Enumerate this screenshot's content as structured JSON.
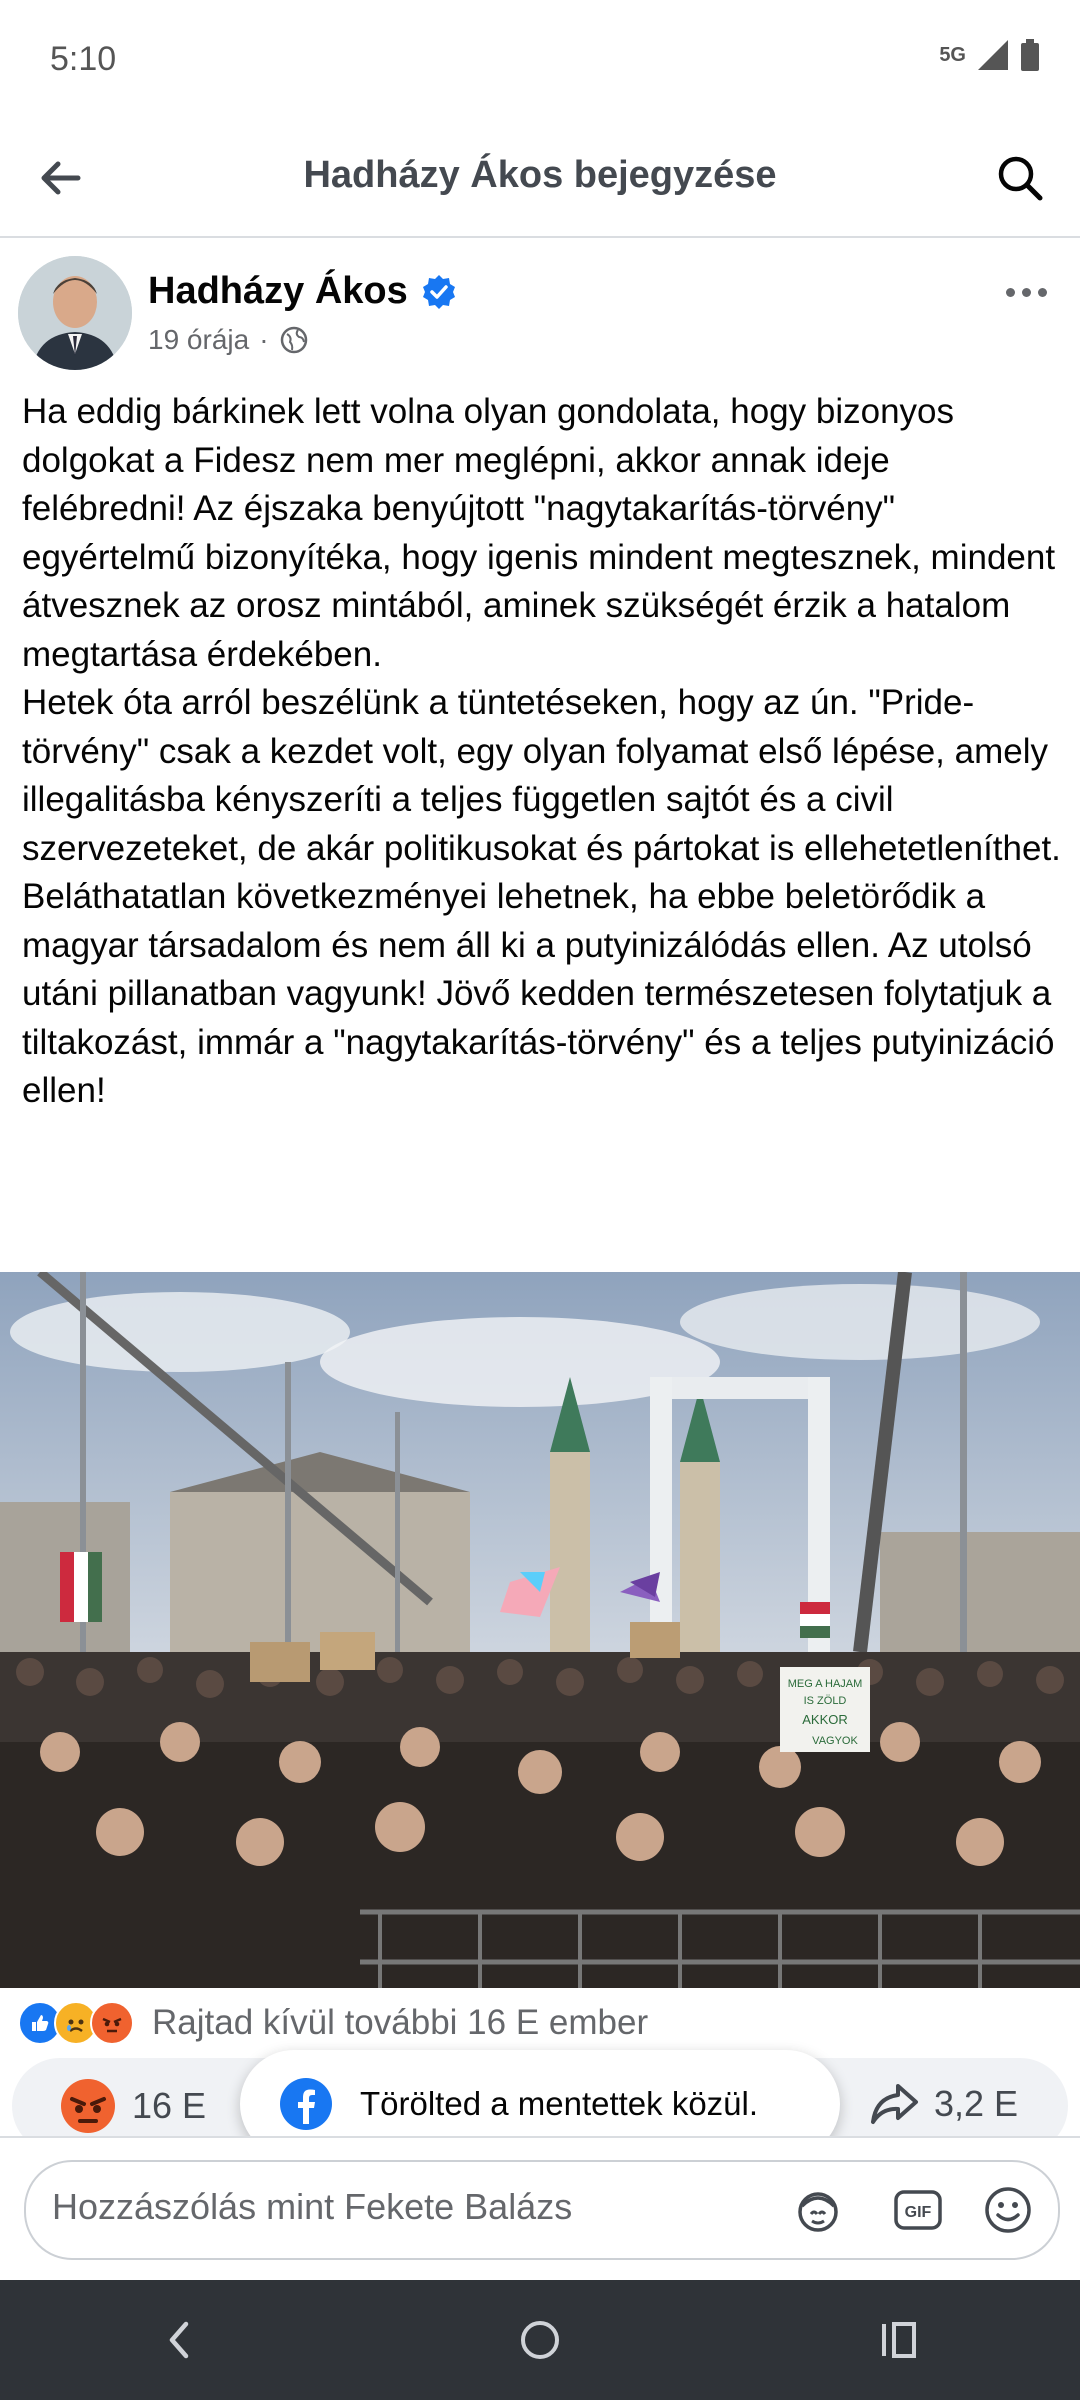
{
  "status_bar": {
    "time": "5:10",
    "network": "5G"
  },
  "app_bar": {
    "title": "Hadházy Ákos bejegyzése"
  },
  "post": {
    "author": "Hadházy Ákos",
    "time_ago": "19 órája",
    "separator": "·",
    "paragraphs": [
      "Ha eddig bárkinek lett volna olyan gondolata, hogy bizonyos dolgokat a Fidesz nem mer meglépni, akkor annak ideje felébredni! Az éjszaka benyújtott \"nagytakarítás-törvény\" egyértelmű bizonyítéka, hogy igenis mindent megtesznek, mindent átvesznek az orosz mintából, aminek szükségét érzik a hatalom megtartása érdekében.",
      "Hetek óta arról beszélünk a tüntetéseken, hogy az ún. \"Pride-törvény\" csak a kezdet volt, egy olyan folyamat első lépése, amely illegalitásba kényszeríti a teljes független sajtót és a civil szervezeteket, de akár politikusokat és pártokat is ellehetetleníthet.",
      "Beláthatatlan következményei lehetnek, ha ebbe beletörődik a magyar társadalom és nem áll ki a putyinizálódás ellen. Az utolsó utáni pillanatban vagyunk! Jövő kedden természetesen folytatjuk a tiltakozást, immár a \"nagytakarítás-törvény\" és a teljes putyinizáció ellen!"
    ],
    "photo_sign": [
      "MEG A HAJAM",
      "IS ZÖLD",
      "AKKOR",
      "VAGYOK"
    ]
  },
  "reactions": {
    "summary": "Rajtad kívül további 16 E ember",
    "count": "16 E",
    "shares": "3,2 E"
  },
  "toast": {
    "text": "Törölted a mentettek közül."
  },
  "composer": {
    "placeholder": "Hozzászólás mint Fekete Balázs",
    "gif_label": "GIF"
  },
  "colors": {
    "accent": "#1877f2",
    "angry": "#f0622f",
    "text_secondary": "#65676b",
    "nav_bar": "#2f3338"
  },
  "icons": [
    "back-arrow-icon",
    "search-icon",
    "verified-badge-icon",
    "globe-icon",
    "more-icon",
    "like-icon",
    "sad-icon",
    "angry-icon",
    "share-icon",
    "facebook-icon",
    "avatar-icon",
    "gif-icon",
    "emoji-icon",
    "nav-back-icon",
    "nav-home-icon",
    "nav-recents-icon"
  ]
}
